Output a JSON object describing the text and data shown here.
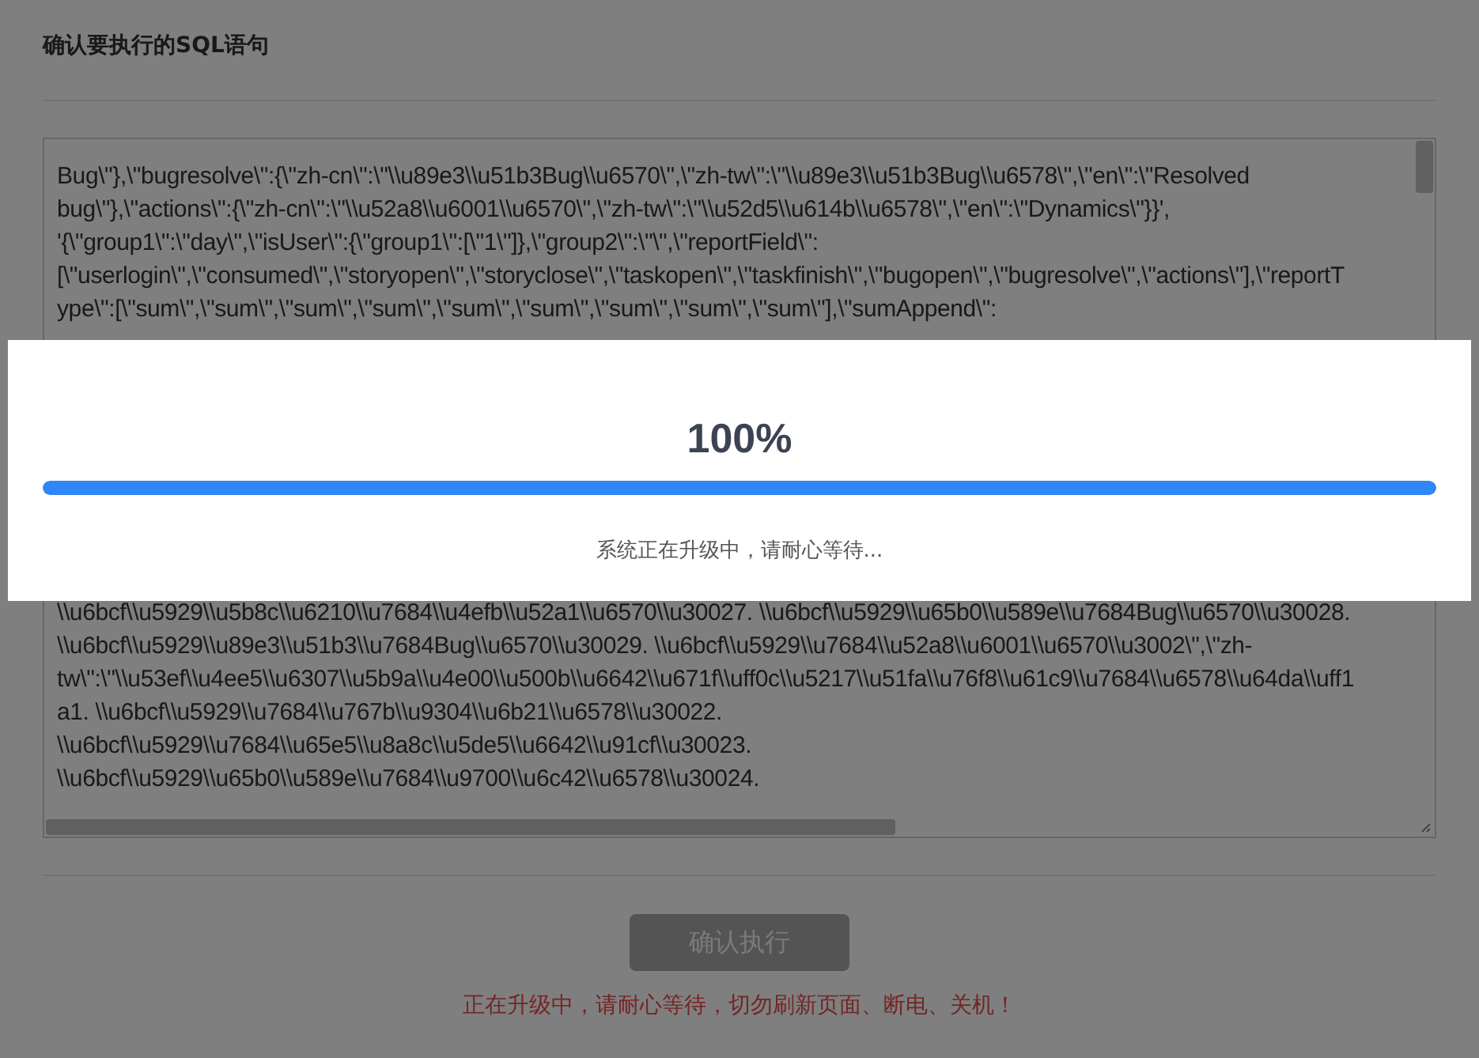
{
  "dialog": {
    "title": "确认要执行的SQL语句",
    "sql_lines_top": [
      "Bug\\\"},\\\"bugresolve\\\":{\\\"zh-cn\\\":\\\"\\\\u89e3\\\\u51b3Bug\\\\u6570\\\",\\\"zh-tw\\\":\\\"\\\\u89e3\\\\u51b3Bug\\\\u6578\\\",\\\"en\\\":\\\"Resolved",
      "bug\\\"},\\\"actions\\\":{\\\"zh-cn\\\":\\\"\\\\u52a8\\\\u6001\\\\u6570\\\",\\\"zh-tw\\\":\\\"\\\\u52d5\\\\u614b\\\\u6578\\\",\\\"en\\\":\\\"Dynamics\\\"}}',",
      "'{\\\"group1\\\":\\\"day\\\",\\\"isUser\\\":{\\\"group1\\\":[\\\"1\\\"]},\\\"group2\\\":\\\"\\\",\\\"reportField\\\":",
      "[\\\"userlogin\\\",\\\"consumed\\\",\\\"storyopen\\\",\\\"storyclose\\\",\\\"taskopen\\\",\\\"taskfinish\\\",\\\"bugopen\\\",\\\"bugresolve\\\",\\\"actions\\\"],\\\"reportT",
      "ype\\\":[\\\"sum\\\",\\\"sum\\\",\\\"sum\\\",\\\"sum\\\",\\\"sum\\\",\\\"sum\\\",\\\"sum\\\",\\\"sum\\\",\\\"sum\\\"],\\\"sumAppend\\\":"
    ],
    "sql_lines_bottom": [
      "\\\\u6bcf\\\\u5929\\\\u5b8c\\\\u6210\\\\u7684\\\\u4efb\\\\u52a1\\\\u6570\\\\u30027. \\\\u6bcf\\\\u5929\\\\u65b0\\\\u589e\\\\u7684Bug\\\\u6570\\\\u30028.",
      "\\\\u6bcf\\\\u5929\\\\u89e3\\\\u51b3\\\\u7684Bug\\\\u6570\\\\u30029. \\\\u6bcf\\\\u5929\\\\u7684\\\\u52a8\\\\u6001\\\\u6570\\\\u3002\\\",\\\"zh-",
      "tw\\\":\\\"\\\\u53ef\\\\u4ee5\\\\u6307\\\\u5b9a\\\\u4e00\\\\u500b\\\\u6642\\\\u671f\\\\uff0c\\\\u5217\\\\u51fa\\\\u76f8\\\\u61c9\\\\u7684\\\\u6578\\\\u64da\\\\uff1",
      "a1. \\\\u6bcf\\\\u5929\\\\u7684\\\\u767b\\\\u9304\\\\u6b21\\\\u6578\\\\u30022.",
      "\\\\u6bcf\\\\u5929\\\\u7684\\\\u65e5\\\\u8a8c\\\\u5de5\\\\u6642\\\\u91cf\\\\u30023.",
      "\\\\u6bcf\\\\u5929\\\\u65b0\\\\u589e\\\\u7684\\\\u9700\\\\u6c42\\\\u6578\\\\u30024."
    ],
    "execute_button": {
      "label": "确认执行",
      "disabled": true
    },
    "warning": "正在升级中，请耐心等待，切勿刷新页面、断电、关机！"
  },
  "upgrade_overlay": {
    "percent": "100%",
    "progress": {
      "level": 1
    },
    "message": "系统正在升级中，请耐心等待..."
  }
}
